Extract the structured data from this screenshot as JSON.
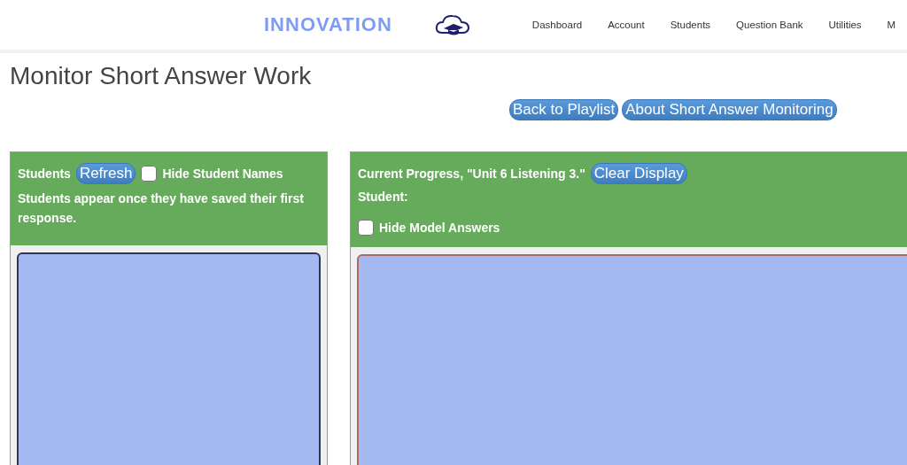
{
  "header": {
    "brand": "INNOVATION",
    "nav": [
      "Dashboard",
      "Account",
      "Students",
      "Question Bank",
      "Utilities",
      "M"
    ]
  },
  "page": {
    "title": "Monitor Short Answer Work",
    "buttons": [
      "Back to Playlist",
      "About Short Answer Monitoring"
    ]
  },
  "students_panel": {
    "label": "Students",
    "refresh": "Refresh",
    "hide_names": {
      "label": "Hide Student Names",
      "checked": false
    },
    "note": "Students appear once they have saved their first response."
  },
  "progress_panel": {
    "label": "Current Progress, \"Unit 6 Listening 3.\"",
    "clear": "Clear Display",
    "student_label": "Student:",
    "hide_answers": {
      "label": "Hide Model Answers",
      "checked": false
    }
  }
}
